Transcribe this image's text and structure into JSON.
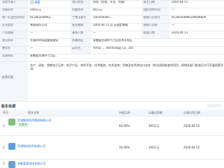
{
  "info": {
    "rows": [
      {
        "c": [
          "法定代表人",
          "胡磊",
          "登记状态",
          "存续（在营、开业、在册）",
          "成立日期",
          "2005-04-15"
        ]
      },
      {
        "c": [
          "注册资本",
          "500万元",
          "实缴资本",
          "80万元",
          "组织机构代码",
          "—"
        ]
      },
      {
        "c": [
          "统一社会信用代码",
          "91340200MA2...",
          "工商注册号",
          "340200000...",
          "纳税人识别号",
          "91340200MA2RN5WB0A"
        ]
      },
      {
        "c": [
          "企业类型",
          "有限责任公司",
          "营业期限",
          "2005-04-15 至 无固定期限",
          "纳税人资质",
          "—"
        ]
      },
      {
        "c": [
          "人员规模",
          "—",
          "参保人数",
          "—",
          "核准日期",
          "2020-04-13"
        ]
      },
      {
        "c": [
          "登记机关",
          "芜湖市市场监督管理局",
          "所属地区",
          "安徽省芜湖市弋江区经济开发区",
          "",
          ""
        ]
      },
      {
        "c": [
          "曾用名",
          "—",
          "英文名",
          "Anhui ... Technology Co., Ltd.",
          "",
          ""
        ]
      },
      {
        "c": [
          "注册地址",
          "安徽省芜湖市弋江区...",
          "",
          "",
          "",
          ""
        ]
      },
      {
        "c": [
          "经营范围",
          "生产、研发、销售电子元件、电子产品；软件开发；技术服务；技术咨询；货物及技术进出口业务（依法须经批准的项目，经相关部门批准后方可开展经营活动）",
          "",
          "",
          "",
          ""
        ]
      }
    ],
    "status_badge": "存续"
  },
  "section": {
    "title": "股东信息",
    "count": "3",
    "columns": [
      "序号",
      "股东名称",
      "持股比例",
      "认缴出资额",
      "认缴出资日期"
    ],
    "rows": [
      {
        "no": "1",
        "name": "芜湖聚智投资管理有限公司",
        "tag": "大股东",
        "ratio": "60.00%",
        "amount": "300万元",
        "date": "2026-04-15"
      },
      {
        "no": "2",
        "name": "芜湖智创投资有限公司",
        "tag": "",
        "ratio": "20.00%",
        "amount": "100万元",
        "date": "2026-04-15"
      },
      {
        "no": "3",
        "name": "安徽某某科技有限公司",
        "tag": "",
        "ratio": "20.00%",
        "amount": "100万元",
        "date": "2026-04-15"
      }
    ]
  },
  "colors": {
    "link": "#1d6fd6",
    "label_bg": "#f2f6fb",
    "border": "#e6eaf0",
    "tag": "#3a9e5b"
  }
}
